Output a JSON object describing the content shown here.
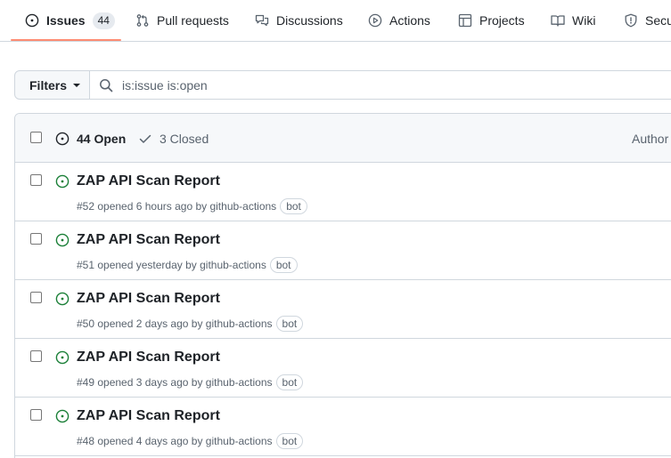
{
  "nav": {
    "tabs": [
      {
        "label": "Issues",
        "counter": "44",
        "icon": "issue-opened-icon"
      },
      {
        "label": "Pull requests",
        "icon": "git-pull-request-icon"
      },
      {
        "label": "Discussions",
        "icon": "comment-discussion-icon"
      },
      {
        "label": "Actions",
        "icon": "play-icon"
      },
      {
        "label": "Projects",
        "icon": "table-icon"
      },
      {
        "label": "Wiki",
        "icon": "book-icon"
      },
      {
        "label": "Secu",
        "icon": "shield-icon"
      }
    ]
  },
  "filter": {
    "filters_label": "Filters",
    "search_value": "is:issue is:open"
  },
  "issues_header": {
    "open_label": "44 Open",
    "closed_label": "3 Closed",
    "author_label": "Author"
  },
  "issues": [
    {
      "title": "ZAP API Scan Report",
      "number": "#52",
      "opened": " opened 6 hours ago by ",
      "author": "github-actions",
      "label": "bot"
    },
    {
      "title": "ZAP API Scan Report",
      "number": "#51",
      "opened": " opened yesterday by ",
      "author": "github-actions",
      "label": "bot"
    },
    {
      "title": "ZAP API Scan Report",
      "number": "#50",
      "opened": " opened 2 days ago by ",
      "author": "github-actions",
      "label": "bot"
    },
    {
      "title": "ZAP API Scan Report",
      "number": "#49",
      "opened": " opened 3 days ago by ",
      "author": "github-actions",
      "label": "bot"
    },
    {
      "title": "ZAP API Scan Report",
      "number": "#48",
      "opened": " opened 4 days ago by ",
      "author": "github-actions",
      "label": "bot"
    }
  ],
  "colors": {
    "open_green": "#1a7f37",
    "nav_underline": "#fd8c73",
    "muted": "#59636e",
    "border": "#d0d7de"
  }
}
